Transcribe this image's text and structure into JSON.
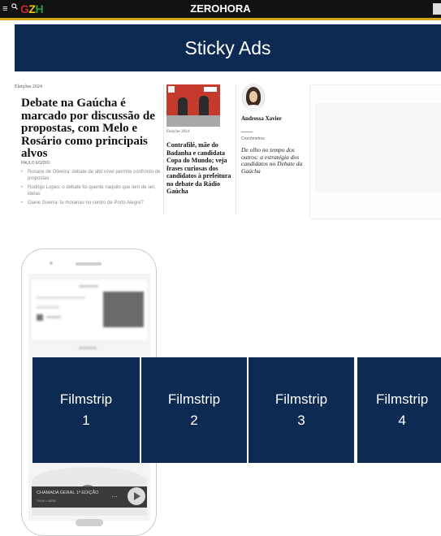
{
  "header": {
    "menu_icon": "hamburger-menu-icon",
    "search_icon": "search-icon",
    "logo_letters": [
      "G",
      "Z",
      "H"
    ],
    "brand": "ZEROHORA",
    "colors": {
      "bar": "#111111",
      "stripe": "#d6a51b",
      "g": "#c9272b",
      "z": "#f2c318",
      "h": "#2c9a3f"
    }
  },
  "sticky_ad": {
    "label": "Sticky Ads",
    "color": "#0d2a52"
  },
  "news": {
    "main": {
      "kicker": "Eleições 2024",
      "headline": "Debate na Gaúcha é marcado por discussão de propostas, com Melo e Rosário como principais alvos",
      "byline": "PAULO EGÍDIO",
      "related": [
        "Rosane de Oliveira: debate de alto nível permite confronto de propostas",
        "Rodrigo Lopes: o debate foi quente naquilo que tem de ser, ideias",
        "Giane Guerra: tu morarias no centro de Porto Alegre?"
      ]
    },
    "second": {
      "kicker": "Eleições 2024",
      "headline": "Contrafilé, mãe do Badanha e candidata Copa do Mundo; veja frases curiosas dos candidatos à prefeitura no debate da Rádio Gaúcha"
    },
    "columnist": {
      "author": "Andressa Xavier",
      "section": "Cronômetros",
      "headline": "De olho no tempo dos outros: a estratégia dos candidatos no Debate da Gaúcha"
    }
  },
  "phone": {
    "video_title": "CHAMADA GERAL 1ª EDIÇÃO",
    "video_meta": "19:00 • 04/08",
    "more_icon": "more-options-icon",
    "play_icon": "play-icon"
  },
  "filmstrip": [
    {
      "label": "Filmstrip\n1"
    },
    {
      "label": "Filmstrip\n2"
    },
    {
      "label": "Filmstrip\n3"
    },
    {
      "label": "Filmstrip\n4"
    }
  ]
}
